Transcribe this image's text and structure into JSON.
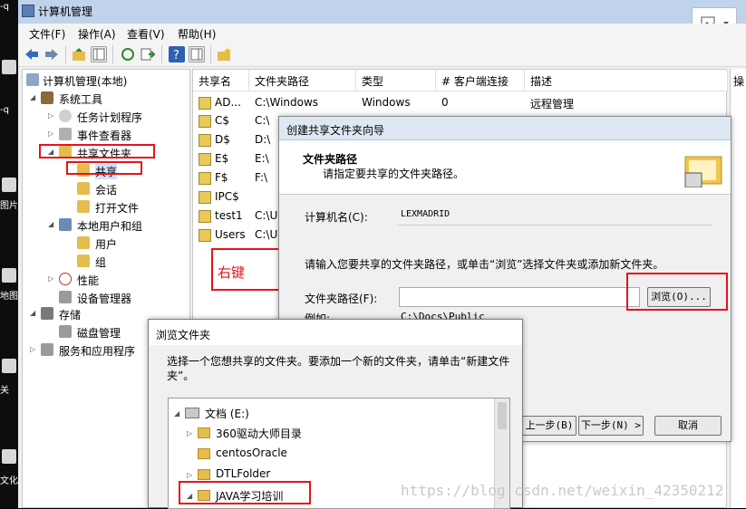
{
  "desktop": {
    "labels": [
      "-q",
      "-q",
      "图片",
      "地图",
      "关",
      "文化"
    ]
  },
  "window": {
    "title": "计算机管理",
    "menu": [
      "文件(F)",
      "操作(A)",
      "查看(V)",
      "帮助(H)"
    ]
  },
  "tree": {
    "root": "计算机管理(本地)",
    "system_tools": "系统工具",
    "task_scheduler": "任务计划程序",
    "event_viewer": "事件查看器",
    "shared_folders": "共享文件夹",
    "shares": "共享",
    "sessions": "会话",
    "open_files": "打开文件",
    "local_users": "本地用户和组",
    "users": "用户",
    "groups": "组",
    "performance": "性能",
    "device_manager": "设备管理器",
    "storage": "存储",
    "disk_mgmt": "磁盘管理",
    "services_apps": "服务和应用程序"
  },
  "list": {
    "headers": [
      "共享名",
      "文件夹路径",
      "类型",
      "# 客户端连接",
      "描述"
    ],
    "rows": [
      {
        "name": "AD...",
        "path": "C:\\Windows",
        "type": "Windows",
        "clients": "0",
        "desc": "远程管理"
      },
      {
        "name": "C$",
        "path": "C:\\",
        "type": "",
        "clients": "",
        "desc": ""
      },
      {
        "name": "D$",
        "path": "D:\\",
        "type": "",
        "clients": "",
        "desc": ""
      },
      {
        "name": "E$",
        "path": "E:\\",
        "type": "",
        "clients": "",
        "desc": ""
      },
      {
        "name": "F$",
        "path": "F:\\",
        "type": "",
        "clients": "",
        "desc": ""
      },
      {
        "name": "IPC$",
        "path": "",
        "type": "",
        "clients": "",
        "desc": ""
      },
      {
        "name": "test1",
        "path": "C:\\U",
        "type": "",
        "clients": "",
        "desc": ""
      },
      {
        "name": "Users",
        "path": "C:\\U",
        "type": "",
        "clients": "",
        "desc": ""
      }
    ],
    "actions_header": "操"
  },
  "annotation": {
    "right_click": "右键"
  },
  "wizard": {
    "title": "创建共享文件夹向导",
    "heading": "文件夹路径",
    "subheading": "请指定要共享的文件夹路径。",
    "computer_label": "计算机名(C):",
    "computer_value": "LEXMADRID",
    "instruction": "请输入您要共享的文件夹路径，或单击“浏览”选择文件夹或添加新文件夹。",
    "path_label": "文件夹路径(F):",
    "path_value": "",
    "browse_button": "浏览(O)...",
    "example_label": "例如:",
    "example_value": "C:\\Docs\\Public",
    "back_button": "上一步(B)",
    "next_button": "下一步(N) >",
    "cancel_button": "取消"
  },
  "browse": {
    "title": "浏览文件夹",
    "instruction": "选择一个您想共享的文件夹。要添加一个新的文件夹，请单击“新建文件夹”。",
    "drive": "文档 (E:)",
    "folders": [
      "360驱动大师目录",
      "centosOracle",
      "DTLFolder",
      "JAVA学习培训"
    ]
  },
  "watermark": "https://blog.csdn.net/weixin_42350212",
  "colors": {
    "highlight_red": "#e8121c",
    "title_bar": "#bfd3ea",
    "annotation_red": "#e8121c"
  }
}
